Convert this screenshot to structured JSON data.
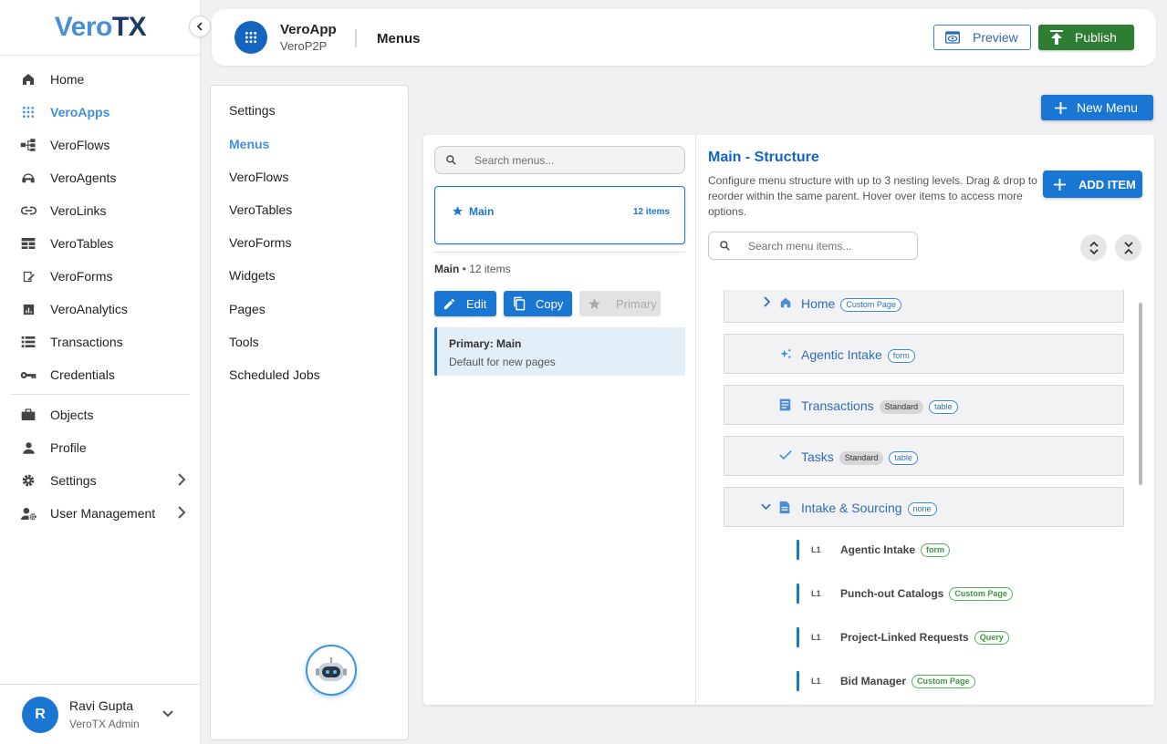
{
  "brand": {
    "name_part1": "Vero",
    "name_part2": "TX"
  },
  "sidebar": {
    "items": [
      {
        "label": "Home",
        "icon": "home-icon"
      },
      {
        "label": "VeroApps",
        "icon": "apps-grid-icon",
        "active": true
      },
      {
        "label": "VeroFlows",
        "icon": "flow-icon"
      },
      {
        "label": "VeroAgents",
        "icon": "agent-icon"
      },
      {
        "label": "VeroLinks",
        "icon": "link-icon"
      },
      {
        "label": "VeroTables",
        "icon": "table-icon"
      },
      {
        "label": "VeroForms",
        "icon": "form-icon"
      },
      {
        "label": "VeroAnalytics",
        "icon": "analytics-icon"
      },
      {
        "label": "Transactions",
        "icon": "list-icon"
      },
      {
        "label": "Credentials",
        "icon": "key-icon"
      }
    ],
    "items2": [
      {
        "label": "Objects",
        "icon": "briefcase-icon"
      },
      {
        "label": "Profile",
        "icon": "person-icon"
      },
      {
        "label": "Settings",
        "icon": "gear-icon"
      },
      {
        "label": "User Management",
        "icon": "user-settings-icon"
      }
    ],
    "user": {
      "initial": "R",
      "name": "Ravi Gupta",
      "role": "VeroTX Admin"
    }
  },
  "header": {
    "app_name": "VeroApp",
    "app_sub": "VeroP2P",
    "title": "Menus",
    "preview_label": "Preview",
    "publish_label": "Publish"
  },
  "subnav": {
    "items": [
      "Settings",
      "Menus",
      "VeroFlows",
      "VeroTables",
      "VeroForms",
      "Widgets",
      "Pages",
      "Tools",
      "Scheduled Jobs"
    ]
  },
  "new_menu_label": "New Menu",
  "menus_panel": {
    "search_placeholder": "Search menus...",
    "menu": {
      "name": "Main",
      "count": "12 items"
    },
    "meta_name": "Main",
    "meta_count": " • 12 items",
    "edit_label": "Edit",
    "copy_label": "Copy",
    "primary_label": "Primary",
    "primary_title": "Primary: Main",
    "primary_sub": "Default for new pages"
  },
  "structure": {
    "title": "Main - Structure",
    "description": "Configure menu structure with up to 3 nesting levels. Drag & drop to reorder within the same parent. Hover over items to access more options.",
    "add_label": "ADD ITEM",
    "search_placeholder": "Search menu items...",
    "items": [
      {
        "label": "Home",
        "icon": "home-icon",
        "badges": [
          "Custom Page"
        ]
      },
      {
        "label": "Agentic Intake",
        "icon": "sparkle-icon",
        "badges": [
          "form"
        ]
      },
      {
        "label": "Transactions",
        "icon": "document-list-icon",
        "badges": [
          "Standard",
          "table"
        ]
      },
      {
        "label": "Tasks",
        "icon": "check-icon",
        "badges": [
          "Standard",
          "table"
        ]
      },
      {
        "label": "Intake & Sourcing",
        "icon": "document-icon",
        "badges": [
          "none"
        ]
      }
    ],
    "children": [
      {
        "level": "L1",
        "label": "Agentic Intake",
        "badge": "form"
      },
      {
        "level": "L1",
        "label": "Punch-out Catalogs",
        "badge": "Custom Page"
      },
      {
        "level": "L1",
        "label": "Project-Linked Requests",
        "badge": "Query"
      },
      {
        "level": "L1",
        "label": "Bid Manager",
        "badge": "Custom Page"
      }
    ]
  },
  "colors": {
    "accent": "#1976d2",
    "publish": "#2e7d32",
    "active_nav": "#3f8fde"
  }
}
